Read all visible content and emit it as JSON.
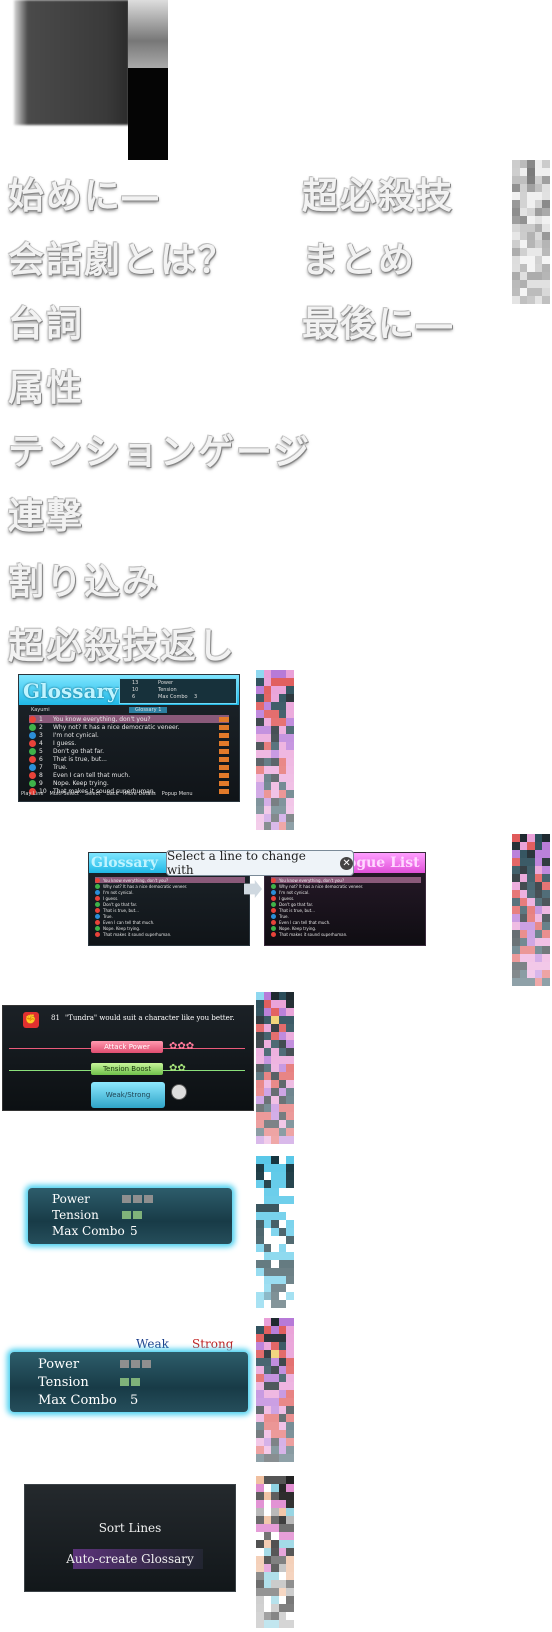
{
  "menu": {
    "left": [
      "始めに―",
      "会話劇とは？",
      "台詞",
      "属性",
      "テンションゲージ",
      "連撃",
      "割り込み",
      "超必殺技返し"
    ],
    "right": [
      "超必殺技",
      "まとめ",
      "最後に―"
    ]
  },
  "glossary_panel": {
    "title": "Glossary",
    "counts": [
      "13",
      "10",
      "6"
    ],
    "stats_labels": [
      "Power",
      "Tension",
      "Max Combo"
    ],
    "max_combo_value": "3",
    "tab_name": "Kayumi",
    "tab_glossary": "Glossary 1",
    "numbers": [
      "1",
      "2",
      "3",
      "4",
      "5",
      "6",
      "7",
      "8",
      "9",
      "10"
    ],
    "lines": [
      "You know everything, don't you?",
      "Why not? It has a nice democratic veneer.",
      "I'm not cynical.",
      "I guess.",
      "Don't go that far.",
      "That is true, but...",
      "True.",
      "Even I can tell that much.",
      "Nope. Keep trying.",
      "That makes it sound superhuman."
    ],
    "footer": [
      "Play Line",
      "Multi-Select",
      "Select",
      "Back",
      "More Details",
      "Popup Menu"
    ]
  },
  "compare_panel": {
    "left_title": "Glossary",
    "right_title": "ogue List",
    "tooltip": "Select a line to change with"
  },
  "attr_panel": {
    "line_num": "81",
    "line_text": "\"Tundra\" would suit a character like you better.",
    "attack_label": "Attack Power",
    "tension_label": "Tension Boost",
    "weak_strong": "Weak/Strong"
  },
  "stats1": {
    "power": "Power",
    "tension": "Tension",
    "max_combo": "Max Combo",
    "max_combo_value": "5",
    "power_level": 3,
    "tension_level": 2
  },
  "stats2": {
    "weak": "Weak",
    "strong": "Strong",
    "power": "Power",
    "tension": "Tension",
    "max_combo": "Max Combo",
    "max_combo_value": "5",
    "power_level": 3,
    "tension_level": 2
  },
  "sort_panel": {
    "sort_lines": "Sort Lines",
    "auto_create": "Auto-create Glossary"
  },
  "colors": {
    "cyan": "#2ec4f0",
    "pink": "#e85ad8",
    "dark": "#141a1f"
  }
}
